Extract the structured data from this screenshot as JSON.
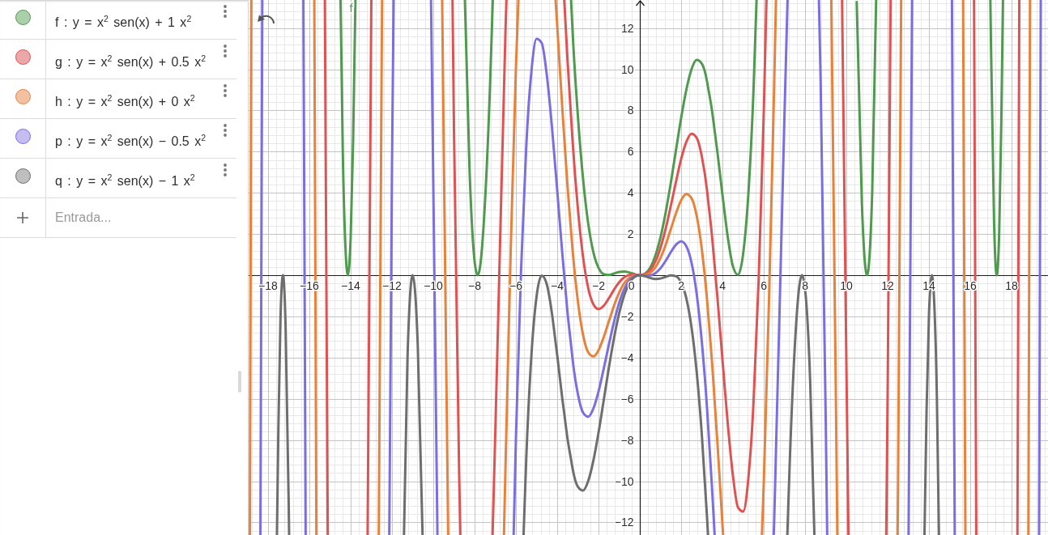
{
  "algebra": {
    "items": [
      {
        "definition": "f : y = x$^{2}$ sen(x) + 1 x$^{2}$",
        "color": "#a9d0a9",
        "visible": true
      },
      {
        "definition": "g : y = x$^{2}$ sen(x) + 0.5 x$^{2}$",
        "color": "#eba8a8",
        "visible": true
      },
      {
        "definition": "h : y = x$^{2}$ sen(x) + 0 x$^{2}$",
        "color": "#f3c1a0",
        "visible": true
      },
      {
        "definition": "p : y = x$^{2}$ sen(x) − 0.5 x$^{2}$",
        "color": "#c3bdf0",
        "visible": true
      },
      {
        "definition": "q : y = x$^{2}$ sen(x) − 1 x$^{2}$",
        "color": "#bfbfbf",
        "visible": true
      }
    ],
    "input": {
      "placeholder": "Entrada..."
    }
  },
  "graph": {
    "origin_label": "0",
    "chart_data": {
      "type": "line",
      "grid": true,
      "xlim": [
        -18.94,
        19.76
      ],
      "ylim": [
        -12.61,
        13.36
      ],
      "xticks": [
        {
          "value": -18,
          "label": "−18"
        },
        {
          "value": -16,
          "label": "−16"
        },
        {
          "value": -14,
          "label": "−14"
        },
        {
          "value": -12,
          "label": "−12"
        },
        {
          "value": -10,
          "label": "−10"
        },
        {
          "value": -8,
          "label": "−8"
        },
        {
          "value": -6,
          "label": "−6"
        },
        {
          "value": -4,
          "label": "−4"
        },
        {
          "value": -2,
          "label": "−2"
        },
        2,
        4,
        6,
        8,
        10,
        12,
        14,
        16,
        18
      ],
      "yticks": [
        {
          "value": -12,
          "label": "−12"
        },
        {
          "value": -10,
          "label": "−10"
        },
        {
          "value": -8,
          "label": "−8"
        },
        {
          "value": -6,
          "label": "−6"
        },
        {
          "value": -4,
          "label": "−4"
        },
        {
          "value": -2,
          "label": "−2"
        },
        2,
        4,
        6,
        8,
        10,
        12
      ],
      "x": [
        -18.88,
        -18.81,
        -18.37,
        -18.28,
        -17.57,
        -17.5,
        -17.4,
        -17.28,
        -17.25,
        -17.15,
        -17,
        -16.98,
        -16.29,
        -16.25,
        -16.18,
        -15.76,
        -15.75,
        -15.66,
        -15.25,
        -15.11,
        -14.49,
        -14.38,
        -14.25,
        -14.14,
        -14,
        -13.88,
        -13.77,
        -13.18,
        -13,
        -12.64,
        -12.5,
        -12.48,
        -12.13,
        -12,
        -11.92,
        -11.42,
        -11.25,
        -11.125,
        -11,
        -10.875,
        -10.75,
        -10.52,
        -10.11,
        -10,
        -9.8,
        -9.57,
        -9.5,
        -9.28,
        -9.07,
        -9,
        -8.75,
        -8.69,
        -8.47,
        -8.25,
        -8,
        -7.85,
        -7.75,
        -7.5,
        -7.25,
        -7.13,
        -7.12,
        -7,
        -6.75,
        -6.58,
        -6.5,
        -6.46,
        -6.25,
        -6.11,
        -6,
        -5.88,
        -5.75,
        -5.63,
        -5.5,
        -5.25,
        -5,
        -4.75,
        -4.5,
        -4.25,
        -4.08,
        -4,
        -3.75,
        -3.66,
        -3.5,
        -3.33,
        -3.25,
        -3,
        -2.75,
        -2.5,
        -2.25,
        -2,
        -1.75,
        -1.5,
        -1.25,
        -1,
        -0.75,
        -0.5,
        -0.25,
        0,
        0.25,
        0.5,
        0.75,
        1,
        1.25,
        1.5,
        1.75,
        2,
        2.25,
        2.5,
        2.75,
        3,
        3.25,
        3.3,
        3.5,
        3.62,
        3.75,
        4,
        4.03,
        4.25,
        4.5,
        4.75,
        5,
        5.25,
        5.5,
        5.65,
        5.75,
        5.91,
        6,
        6.13,
        6.25,
        6.48,
        6.5,
        6.59,
        6.75,
        7,
        7.14,
        7.15,
        7.25,
        7.5,
        7.75,
        7.85,
        8,
        8.25,
        8.45,
        8.67,
        8.75,
        9,
        9.07,
        9.27,
        9.5,
        9.56,
        9.79,
        10,
        10.1,
        10.5,
        10.75,
        10.875,
        11,
        11.125,
        11.25,
        11.44,
        11.93,
        12,
        12.14,
        12.48,
        12.5,
        12.65,
        13.01,
        13.18,
        13.78,
        13.88,
        14,
        14.14,
        14.25,
        14.38,
        14.48,
        15.11,
        15.245,
        15.65,
        15.75,
        15.76,
        16.18,
        16.25,
        16.29,
        16.97,
        17,
        17.15,
        17.25,
        17.28,
        17.4,
        17.5,
        17.58,
        18.28,
        18.37,
        18.81,
        18.89,
        19.33,
        19.41
      ],
      "series": [
        {
          "color": "#4f9a4f",
          "values": [
            null,
            null,
            null,
            null,
            null,
            null,
            null,
            null,
            null,
            null,
            null,
            null,
            null,
            null,
            null,
            null,
            null,
            null,
            null,
            null,
            13.35,
            5.9,
            1.29,
            0,
            1.84,
            6.6,
            13.35,
            null,
            null,
            null,
            null,
            null,
            null,
            null,
            null,
            null,
            null,
            null,
            null,
            null,
            null,
            null,
            null,
            null,
            null,
            null,
            null,
            null,
            null,
            null,
            null,
            null,
            13.35,
            5.27,
            0.68,
            0,
            0.32,
            3.49,
            9.3,
            13.04,
            13.35,
            null,
            null,
            null,
            null,
            null,
            null,
            null,
            null,
            null,
            null,
            null,
            null,
            null,
            null,
            null,
            null,
            null,
            null,
            null,
            null,
            null,
            null,
            13.35,
            11.71,
            7.73,
            4.68,
            2.51,
            1.12,
            0.36,
            0.05,
            0.01,
            0.08,
            0.16,
            0.18,
            0.13,
            0.05,
            0,
            0.08,
            0.37,
            0.95,
            1.84,
            3.05,
            4.49,
            6.08,
            7.64,
            9,
            9.99,
            10.45,
            10.27,
            9.42,
            9.13,
            7.95,
            7.02,
            6.02,
            3.89,
            3.65,
            1.9,
            0.46,
            0.02,
            1.03,
            3.89,
            8.91,
            13.35,
            null,
            null,
            null,
            null,
            null,
            null,
            null,
            null,
            null,
            null,
            null,
            null,
            null,
            null,
            null,
            null,
            null,
            null,
            null,
            null,
            null,
            null,
            null,
            null,
            null,
            null,
            null,
            null,
            null,
            13.26,
            3.47,
            0.88,
            0,
            1.01,
            4.07,
            13.35,
            null,
            null,
            null,
            null,
            null,
            null,
            null,
            null,
            null,
            null,
            null,
            null,
            null,
            null,
            null,
            null,
            null,
            null,
            null,
            null,
            null,
            null,
            null,
            13.35,
            11.16,
            2.52,
            0.12,
            0,
            2.17,
            7.46,
            13.35,
            null,
            null,
            null,
            null,
            null,
            null
          ]
        },
        {
          "color": "#e05252",
          "values": [
            null,
            null,
            null,
            null,
            null,
            null,
            null,
            null,
            null,
            null,
            null,
            null,
            null,
            null,
            null,
            null,
            null,
            null,
            13.35,
            -12.6,
            null,
            null,
            null,
            null,
            null,
            null,
            null,
            -12.6,
            13.35,
            null,
            null,
            null,
            null,
            null,
            null,
            null,
            null,
            null,
            null,
            null,
            null,
            null,
            null,
            null,
            null,
            null,
            null,
            null,
            13.35,
            7.12,
            -9.55,
            -12.6,
            null,
            null,
            null,
            null,
            null,
            null,
            null,
            -12.6,
            -12.22,
            -7.69,
            2.28,
            8.92,
            12.04,
            13.35,
            null,
            null,
            null,
            null,
            null,
            null,
            null,
            null,
            null,
            null,
            null,
            null,
            null,
            null,
            null,
            13.35,
            10.42,
            7.7,
            6.42,
            3.23,
            0.89,
            -0.62,
            -1.41,
            -1.64,
            -1.48,
            -1.12,
            -0.7,
            -0.34,
            -0.1,
            0.01,
            0.02,
            0,
            0.05,
            0.24,
            0.66,
            1.34,
            2.26,
            3.37,
            4.54,
            5.64,
            6.47,
            6.87,
            6.67,
            5.77,
            4.14,
            3.68,
            1.83,
            0.47,
            -1.01,
            -4.11,
            -4.47,
            -7.13,
            -9.67,
            -11.27,
            -11.47,
            -9.89,
            -6.22,
            -2.65,
            -0.27,
            4.98,
            7.94,
            13.35,
            null,
            null,
            null,
            null,
            null,
            null,
            null,
            null,
            null,
            null,
            null,
            null,
            null,
            null,
            null,
            null,
            null,
            null,
            null,
            null,
            null,
            null,
            13.35,
            -4.4,
            -12.6,
            null,
            null,
            null,
            null,
            null,
            null,
            null,
            -12.6,
            -5.27,
            13.35,
            null,
            null,
            null,
            null,
            null,
            null,
            null,
            null,
            null,
            null,
            null,
            null,
            null,
            null,
            null,
            null,
            null,
            13.35,
            -4.19,
            -12.6,
            null,
            null,
            null,
            null,
            null,
            null,
            null,
            null,
            -12.6,
            13.35,
            null,
            null,
            null,
            null
          ]
        },
        {
          "color": "#e8813a",
          "values": [
            -12.6,
            13.35,
            null,
            null,
            null,
            null,
            null,
            null,
            null,
            null,
            null,
            null,
            null,
            null,
            null,
            13.35,
            10.42,
            -12.6,
            null,
            null,
            null,
            null,
            null,
            null,
            null,
            null,
            null,
            null,
            null,
            -12.6,
            10.36,
            13.35,
            null,
            null,
            null,
            null,
            null,
            null,
            null,
            null,
            null,
            null,
            null,
            null,
            null,
            13.35,
            6.78,
            -12.6,
            null,
            null,
            null,
            null,
            null,
            null,
            null,
            null,
            null,
            null,
            null,
            null,
            null,
            null,
            null,
            -12.6,
            -9.09,
            -7.43,
            1.3,
            6.21,
            10.06,
            13.35,
            null,
            null,
            null,
            null,
            null,
            null,
            null,
            null,
            13.35,
            12.11,
            8.04,
            6.69,
            4.3,
            2.15,
            1.14,
            -1.27,
            -2.89,
            -3.74,
            -3.94,
            -3.64,
            -3.01,
            -2.24,
            -1.48,
            -0.84,
            -0.38,
            -0.12,
            -0.02,
            0,
            0.02,
            0.12,
            0.38,
            0.84,
            1.48,
            2.24,
            3.01,
            3.64,
            3.94,
            3.74,
            2.89,
            1.27,
            -1.14,
            -1.77,
            -4.3,
            -6.1,
            -8.04,
            -12.11,
            -12.6,
            null,
            null,
            null,
            null,
            null,
            null,
            null,
            null,
            -12.6,
            -10.06,
            -5.5,
            -1.3,
            8.26,
            9.09,
            13.35,
            null,
            null,
            null,
            null,
            null,
            null,
            null,
            null,
            null,
            null,
            null,
            null,
            null,
            null,
            null,
            13.35,
            -6.78,
            -12.6,
            null,
            null,
            null,
            null,
            null,
            null,
            null,
            null,
            null,
            null,
            null,
            null,
            null,
            -12.6,
            -10.36,
            13.35,
            null,
            null,
            null,
            null,
            null,
            null,
            null,
            null,
            null,
            null,
            null,
            13.35,
            -10.42,
            -12.6,
            null,
            null,
            null,
            null,
            null,
            null,
            null,
            null,
            null,
            null,
            null,
            null,
            null,
            -12.6,
            13.35,
            null,
            null
          ]
        },
        {
          "color": "#7a6ee0",
          "values": [
            null,
            null,
            -12.6,
            13.35,
            null,
            null,
            null,
            null,
            null,
            null,
            null,
            null,
            13.35,
            4.19,
            -12.6,
            null,
            null,
            null,
            null,
            null,
            null,
            null,
            null,
            null,
            null,
            null,
            null,
            null,
            null,
            null,
            null,
            null,
            -12.6,
            5.27,
            13.35,
            null,
            null,
            null,
            null,
            null,
            null,
            null,
            13.35,
            4.4,
            -12.6,
            null,
            null,
            null,
            null,
            null,
            null,
            null,
            null,
            null,
            null,
            null,
            null,
            null,
            null,
            null,
            null,
            null,
            null,
            null,
            null,
            null,
            null,
            -12.6,
            -7.94,
            -4,
            0.27,
            3.13,
            6.22,
            9.89,
            11.47,
            11.27,
            9.67,
            7.13,
            5.08,
            4.11,
            1.01,
            -0.01,
            -1.83,
            -3.4,
            -4.14,
            -5.77,
            -6.67,
            -6.87,
            -6.47,
            -5.64,
            -4.54,
            -3.37,
            -2.26,
            -1.34,
            -0.66,
            -0.24,
            -0.05,
            0,
            -0.02,
            -0.01,
            0.1,
            0.34,
            0.7,
            1.12,
            1.48,
            1.64,
            1.41,
            0.62,
            -0.89,
            -3.23,
            -6.42,
            -7.22,
            -10.42,
            -12.6,
            null,
            null,
            null,
            null,
            null,
            null,
            null,
            null,
            null,
            null,
            null,
            null,
            null,
            null,
            null,
            -12.6,
            -12.04,
            -8.53,
            -2.28,
            7.69,
            12.97,
            13.35,
            null,
            null,
            null,
            null,
            null,
            null,
            null,
            13.35,
            9.55,
            -7.12,
            -12.6,
            null,
            null,
            null,
            null,
            null,
            null,
            null,
            null,
            null,
            null,
            null,
            null,
            null,
            null,
            null,
            null,
            null,
            null,
            null,
            -12.6,
            13.35,
            null,
            null,
            null,
            null,
            null,
            null,
            null,
            13.35,
            -12.6,
            null,
            null,
            null,
            null,
            null,
            null,
            null,
            null,
            null,
            null,
            null,
            null,
            null,
            null,
            null,
            null,
            null,
            null,
            -12.6,
            13.35
          ]
        },
        {
          "color": "#6e6e6e",
          "values": [
            null,
            null,
            null,
            null,
            -12.6,
            -7.46,
            -2.17,
            0,
            -0.12,
            -2.52,
            -11.16,
            -12.6,
            null,
            null,
            null,
            null,
            null,
            null,
            null,
            null,
            null,
            null,
            null,
            null,
            null,
            null,
            null,
            null,
            null,
            null,
            null,
            null,
            null,
            null,
            null,
            -12.6,
            -4.07,
            -1.01,
            0,
            -0.88,
            -3.47,
            -12.6,
            null,
            null,
            null,
            null,
            null,
            null,
            null,
            null,
            null,
            null,
            null,
            null,
            null,
            null,
            null,
            null,
            null,
            null,
            null,
            null,
            null,
            null,
            null,
            null,
            null,
            null,
            null,
            null,
            null,
            -12.6,
            -8.91,
            -3.89,
            -1.03,
            -0.02,
            -0.46,
            -1.9,
            -3.25,
            -3.89,
            -6.02,
            -6.71,
            -7.95,
            -8.95,
            -9.42,
            -10.27,
            -10.45,
            -9.99,
            -9,
            -7.64,
            -6.08,
            -4.49,
            -3.05,
            -1.84,
            -0.95,
            -0.37,
            -0.08,
            0,
            -0.05,
            -0.13,
            -0.18,
            -0.16,
            -0.08,
            -0.01,
            -0.05,
            -0.36,
            -1.12,
            -2.51,
            -4.68,
            -7.73,
            -11.71,
            -12.6,
            null,
            null,
            null,
            null,
            null,
            null,
            null,
            null,
            null,
            null,
            null,
            null,
            null,
            null,
            null,
            null,
            null,
            null,
            null,
            null,
            null,
            null,
            -12.6,
            -12.3,
            -9.3,
            -3.49,
            -0.32,
            0,
            -0.68,
            -5.27,
            -12.6,
            null,
            null,
            null,
            null,
            null,
            null,
            null,
            null,
            null,
            null,
            null,
            null,
            null,
            null,
            null,
            null,
            null,
            null,
            null,
            null,
            null,
            null,
            null,
            null,
            null,
            -12.6,
            -6.6,
            -1.84,
            0,
            -1.29,
            -5.9,
            -12.6,
            null,
            null,
            null,
            null,
            null,
            null,
            null,
            null,
            null,
            null,
            null,
            null,
            null,
            null,
            null,
            null,
            null,
            null,
            null,
            null,
            null,
            null
          ]
        }
      ],
      "annotations": [
        "f"
      ]
    }
  }
}
